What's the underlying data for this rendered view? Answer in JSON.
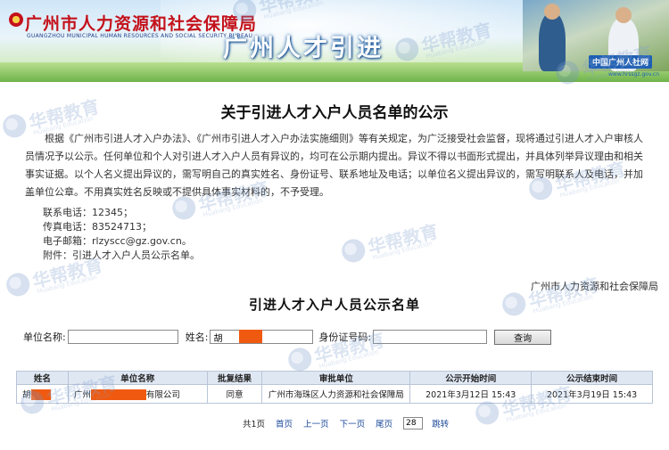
{
  "banner": {
    "org_name": "广州市人力资源和社会保障局",
    "org_name_en": "GUANGZHOU MUNICIPAL HUMAN RESOURCES AND SOCIAL SECURITY BUREAU",
    "title": "广州人才引进",
    "partner_logo": "中国广州人社网",
    "partner_url": "www.hrssgz.gov.cn"
  },
  "watermark": {
    "cn": "华帮教育",
    "en": "Huabang Education"
  },
  "notice": {
    "title": "关于引进人才入户人员名单的公示",
    "body": "根据《广州市引进人才入户办法》、《广州市引进人才入户办法实施细则》等有关规定，为广泛接受社会监督，现将通过引进人才入户审核人员情况予以公示。任何单位和个人对引进人才入户人员有异议的，均可在公示期内提出。异议不得以书面形式提出，并具体列举异议理由和相关事实证据。以个人名义提出异议的，需写明自己的真实姓名、身份证号、联系地址及电话；以单位名义提出异议的，需写明联系人及电话，并加盖单位公章。不用真实姓名反映或不提供具体事实材料的，不予受理。",
    "phone": "联系电话：12345；",
    "fax": "传真电话：83524713；",
    "email": "电子邮箱：rlzyscc@gz.gov.cn。",
    "attachment": "附件：引进人才入户人员公示名单。",
    "signature": "广州市人力资源和社会保障局"
  },
  "list": {
    "title": "引进人才入户人员公示名单",
    "search": {
      "unit_label": "单位名称:",
      "unit_value": "",
      "name_label": "姓名:",
      "name_value": "胡",
      "id_label": "身份证号码:",
      "id_value": "",
      "query_button": "查询"
    },
    "columns": [
      "姓名",
      "单位名称",
      "批复结果",
      "审批单位",
      "公示开始时间",
      "公示结束时间"
    ],
    "rows": [
      {
        "name": "胡",
        "unit_prefix": "广州",
        "unit_suffix": "有限公司",
        "result": "同意",
        "approver": "广州市海珠区人力资源和社会保障局",
        "start": "2021年3月12日 15:43",
        "end": "2021年3月19日 15:43"
      }
    ],
    "pager": {
      "total": "共1页",
      "first": "首页",
      "prev": "上一页",
      "next": "下一页",
      "last": "尾页",
      "page_input": "28",
      "jump": "跳转"
    }
  },
  "colors": {
    "brand_red": "#c4121b",
    "redaction": "#f05a10",
    "header_bg": "#dfe7f2",
    "link": "#1c4a9a"
  }
}
